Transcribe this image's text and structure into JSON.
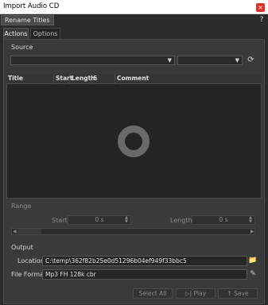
{
  "window": {
    "title": "Import Audio CD",
    "close_glyph": "×"
  },
  "toolbar": {
    "rename_label": "Rename Titles",
    "help_glyph": "?"
  },
  "tabs": [
    {
      "label": "Actions",
      "active": true
    },
    {
      "label": "Options",
      "active": false
    }
  ],
  "source": {
    "label": "Source",
    "combo1_value": "",
    "combo2_value": "",
    "arrow_glyph": "▼",
    "refresh_glyph": "⟳"
  },
  "list": {
    "columns": [
      "Title",
      "Start",
      "Length",
      "6",
      "Comment"
    ],
    "rows": [],
    "empty_icon": "cd-icon"
  },
  "range": {
    "label": "Range",
    "start_label": "Start",
    "start_value": "0 s",
    "length_label": "Length",
    "length_value": "0 s",
    "slider_left_glyph": "◀",
    "slider_right_glyph": "▶"
  },
  "output": {
    "label": "Output",
    "location_label": "Location",
    "location_value": "C:\\temp\\362f82b25e0d51296b04ef949f33bbc5",
    "fileformat_label": "File Format",
    "fileformat_value": "Mp3 FH 128k cbr"
  },
  "buttons": {
    "select_all": "Select All",
    "play": "Play",
    "save": "Save"
  },
  "colors": {
    "background": "#2b2b2b",
    "panel": "#3a3a3a",
    "close": "#d9342b"
  }
}
